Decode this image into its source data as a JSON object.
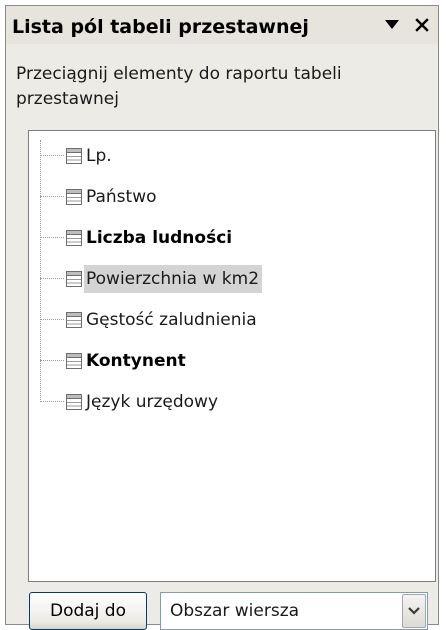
{
  "pane": {
    "title": "Lista pól tabeli przestawnej",
    "menu_icon": "triangle-down-icon",
    "close_icon": "close-icon"
  },
  "instruction": "Przeciągnij elementy do raportu tabeli przestawnej",
  "fields": [
    {
      "label": "Lp.",
      "bold": false,
      "selected": false
    },
    {
      "label": "Państwo",
      "bold": false,
      "selected": false
    },
    {
      "label": "Liczba ludności",
      "bold": true,
      "selected": false
    },
    {
      "label": "Powierzchnia w km2",
      "bold": false,
      "selected": true
    },
    {
      "label": "Gęstość zaludnienia",
      "bold": false,
      "selected": false
    },
    {
      "label": "Kontynent",
      "bold": true,
      "selected": false
    },
    {
      "label": "Język urzędowy",
      "bold": false,
      "selected": false
    }
  ],
  "footer": {
    "add_button_label": "Dodaj do",
    "area_select_value": "Obszar wiersza",
    "dropdown_icon": "chevron-down-icon"
  },
  "colors": {
    "pane_background": "#ecebe6",
    "selected_row": "#d4d4d4",
    "button_border": "#003c74"
  }
}
